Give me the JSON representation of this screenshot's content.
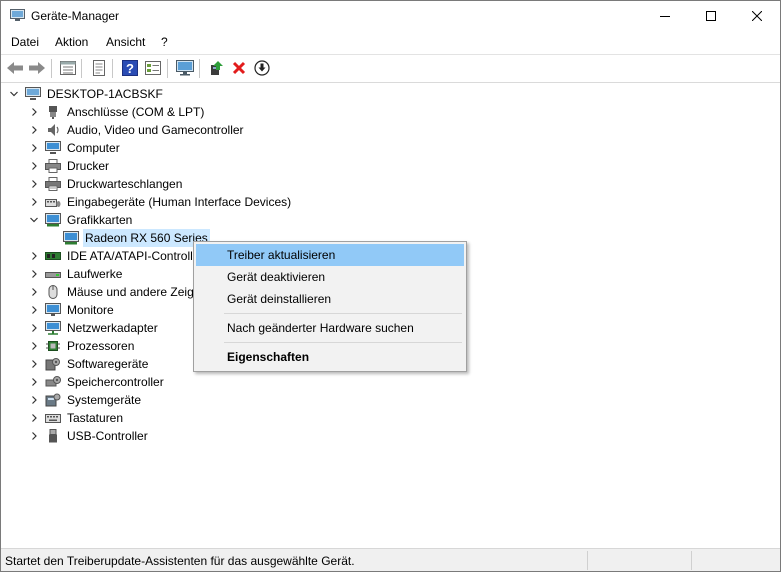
{
  "window": {
    "title": "Geräte-Manager"
  },
  "menu": {
    "items": [
      "Datei",
      "Aktion",
      "Ansicht",
      "?"
    ]
  },
  "toolbar": {
    "buttons": [
      "back-arrow-icon",
      "forward-arrow-icon",
      "properties-grid-icon",
      "driver-details-icon",
      "help-icon",
      "view-list-icon",
      "monitor-scan-icon",
      "update-driver-icon",
      "remove-device-icon",
      "download-circle-icon"
    ]
  },
  "tree": {
    "root": "DESKTOP-1ACBSKF",
    "items": [
      {
        "label": "Anschlüsse (COM & LPT)",
        "icon": "port-plug-icon"
      },
      {
        "label": "Audio, Video und Gamecontroller",
        "icon": "speaker-icon"
      },
      {
        "label": "Computer",
        "icon": "computer-monitor-icon"
      },
      {
        "label": "Drucker",
        "icon": "printer-icon"
      },
      {
        "label": "Druckwarteschlangen",
        "icon": "print-queue-icon"
      },
      {
        "label": "Eingabegeräte (Human Interface Devices)",
        "icon": "hid-icon"
      },
      {
        "label": "Grafikkarten",
        "icon": "display-adapter-icon",
        "expanded": true,
        "children": [
          {
            "label": "Radeon RX 560 Series",
            "icon": "display-adapter-icon",
            "selected": true
          }
        ]
      },
      {
        "label": "IDE ATA/ATAPI-Controller",
        "icon": "ide-controller-icon"
      },
      {
        "label": "Laufwerke",
        "icon": "disk-drive-icon"
      },
      {
        "label": "Mäuse und andere Zeigegeräte",
        "icon": "mouse-icon"
      },
      {
        "label": "Monitore",
        "icon": "monitor-icon"
      },
      {
        "label": "Netzwerkadapter",
        "icon": "network-adapter-icon"
      },
      {
        "label": "Prozessoren",
        "icon": "cpu-chip-icon"
      },
      {
        "label": "Softwaregeräte",
        "icon": "software-device-icon"
      },
      {
        "label": "Speichercontroller",
        "icon": "storage-controller-icon"
      },
      {
        "label": "Systemgeräte",
        "icon": "system-device-icon"
      },
      {
        "label": "Tastaturen",
        "icon": "keyboard-icon"
      },
      {
        "label": "USB-Controller",
        "icon": "usb-icon"
      }
    ]
  },
  "context_menu": {
    "items": [
      {
        "label": "Treiber aktualisieren",
        "highlighted": true
      },
      {
        "label": "Gerät deaktivieren"
      },
      {
        "label": "Gerät deinstallieren"
      },
      {
        "label": "Nach geänderter Hardware suchen"
      },
      {
        "label": "Eigenschaften",
        "bold": true
      }
    ]
  },
  "status": {
    "text": "Startet den Treiberupdate-Assistenten für das ausgewählte Gerät."
  },
  "colors": {
    "selection": "#cce8ff",
    "menu_highlight": "#91c9f7",
    "remove_red": "#e21c1c",
    "help_blue": "#2a4cb4"
  }
}
